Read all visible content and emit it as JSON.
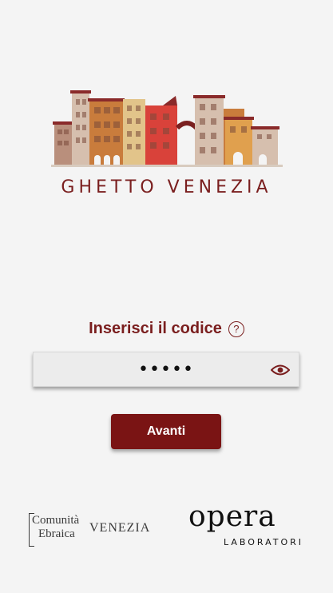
{
  "brand": {
    "title": "GHETTO VENEZIA",
    "accent_color": "#7a1e1e"
  },
  "login": {
    "prompt": "Inserisci il codice",
    "help_icon": "question-circle-icon",
    "code_value": "•••••",
    "reveal_icon": "eye-icon",
    "submit_label": "Avanti"
  },
  "footer": {
    "partner_left": {
      "line1": "Comunità",
      "line2": "Ebraica",
      "line3": "VENEZIA"
    },
    "partner_right": {
      "name": "opera",
      "subtitle": "LABORATORI"
    }
  }
}
